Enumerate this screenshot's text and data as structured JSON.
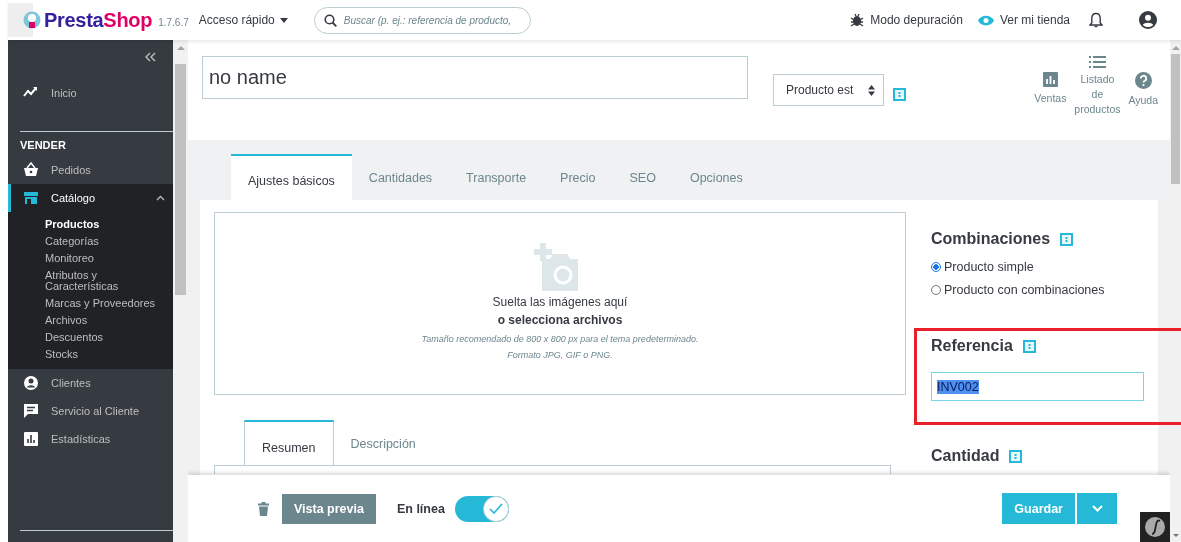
{
  "header": {
    "logo": {
      "first": "Presta",
      "second": "Shop"
    },
    "version": "1.7.6.7",
    "quick_access": "Acceso rápido",
    "search": {
      "placeholder": "Buscar (p. ej.: referencia de producto,"
    },
    "debug_mode": "Modo depuración",
    "view_store": "Ver mi tienda"
  },
  "sidebar": {
    "items": [
      {
        "kind": "link",
        "label": "Inicio",
        "selected": false
      },
      {
        "kind": "heading",
        "label": "VENDER"
      },
      {
        "kind": "link",
        "label": "Pedidos",
        "selected": false
      },
      {
        "kind": "link",
        "label": "Catálogo",
        "selected": true,
        "expanded": true,
        "children": [
          {
            "label": "Productos",
            "selected": true
          },
          {
            "label": "Categorías",
            "selected": false
          },
          {
            "label": "Monitoreo",
            "selected": false
          },
          {
            "label": "Atributos y Características",
            "selected": false
          },
          {
            "label": "Marcas y Proveedores",
            "selected": false
          },
          {
            "label": "Archivos",
            "selected": false
          },
          {
            "label": "Descuentos",
            "selected": false
          },
          {
            "label": "Stocks",
            "selected": false
          }
        ]
      },
      {
        "kind": "link",
        "label": "Clientes",
        "selected": false
      },
      {
        "kind": "link",
        "label": "Servicio al Cliente",
        "selected": false
      },
      {
        "kind": "link",
        "label": "Estadísticas",
        "selected": false
      }
    ]
  },
  "product": {
    "name": {
      "value": "no name"
    },
    "type_select": {
      "value": "Producto est"
    },
    "toolbar": [
      {
        "label": "Ventas"
      },
      {
        "label": "Listado de productos"
      },
      {
        "label": "Ayuda"
      }
    ],
    "tabs": [
      {
        "label": "Ajustes básicos",
        "selected": true
      },
      {
        "label": "Cantidades",
        "selected": false
      },
      {
        "label": "Transporte",
        "selected": false
      },
      {
        "label": "Precio",
        "selected": false
      },
      {
        "label": "SEO",
        "selected": false
      },
      {
        "label": "Opciones",
        "selected": false
      }
    ],
    "dropzone": {
      "line1": "Suelta las imágenes aquí",
      "line2": "o selecciona archivos",
      "hint": "Tamaño recomendado de 800 x 800 px para el tema predeterminado.",
      "formats": "Formato JPG, GIF o PNG."
    },
    "description_tabs": [
      {
        "label": "Resumen",
        "selected": true
      },
      {
        "label": "Descripción",
        "selected": false
      }
    ],
    "combinations": {
      "title": "Combinaciones",
      "options": [
        {
          "label": "Producto simple",
          "selected": true
        },
        {
          "label": "Producto con combinaciones",
          "selected": false
        }
      ]
    },
    "reference": {
      "title": "Referencia",
      "value": "INV002"
    },
    "quantity": {
      "title": "Cantidad"
    }
  },
  "footer": {
    "preview_button": "Vista previa",
    "online": {
      "label": "En línea",
      "on": true
    },
    "save_button": "Guardar"
  }
}
